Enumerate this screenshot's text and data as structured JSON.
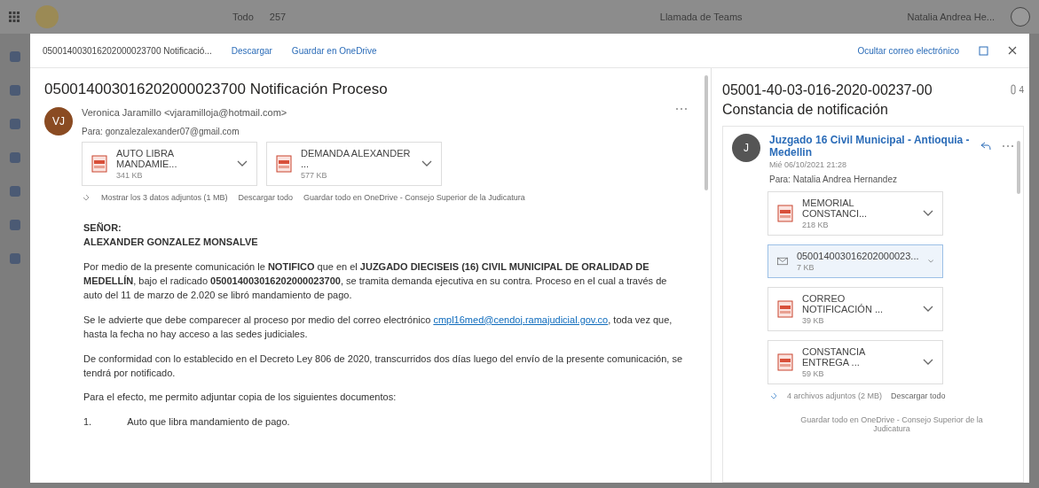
{
  "topbar": {
    "scope": "Todo",
    "count": "257",
    "teams_button": "Llamada de Teams",
    "user_name": "Natalia Andrea He..."
  },
  "header": {
    "title": "050014003016202000023700 Notificació...",
    "actions": [
      "Descargar",
      "Guardar en OneDrive"
    ],
    "hide_button": "Ocultar correo electrónico"
  },
  "message": {
    "subject": "050014003016202000023700 Notificación Proceso",
    "avatar": "VJ",
    "sender": "Veronica Jaramillo <vjaramilloja@hotmail.com>",
    "to_label": "Para:",
    "to": "gonzalezalexander07@gmail.com",
    "attachments": [
      {
        "name": "AUTO LIBRA MANDAMIE...",
        "size": "341 KB",
        "kind": "pdf"
      },
      {
        "name": "DEMANDA ALEXANDER ...",
        "size": "577 KB",
        "kind": "pdf"
      }
    ],
    "attachment_summary": "Mostrar los 3 datos adjuntos (1 MB)",
    "download_all": "Descargar todo",
    "save_all": "Guardar todo en OneDrive - Consejo Superior de la Judicatura",
    "greeting": [
      "SEÑOR:",
      "ALEXANDER GONZALEZ MONSALVE"
    ],
    "paragraphs": [
      {
        "text": "Por medio de la presente comunicación le **NOTIFICO** que en el **JUZGADO DIECISEIS (16) CIVIL MUNICIPAL DE ORALIDAD DE MEDELLÍN**, bajo el radicado **050014003016202000023700**, se tramita demanda ejecutiva en su contra. Proceso en el cual a través de auto del 11 de marzo de 2.020 se libró mandamiento de pago."
      },
      {
        "text": "Se le advierte que debe comparecer al proceso por medio del correo electrónico ",
        "link": "cmpl16med@cendoj.ramajudicial.gov.co",
        "after": ", toda vez que, hasta la fecha no hay acceso a las sedes judiciales."
      },
      {
        "text": "De conformidad con lo establecido en el Decreto Ley 806 de 2020, transcurridos dos días luego del envío de la presente comunicación, se tendrá por notificado."
      },
      {
        "text": "Para el efecto, me permito adjuntar copia de los siguientes documentos:"
      }
    ],
    "list": [
      {
        "number": "1.",
        "text": "Auto que libra mandamiento de pago."
      }
    ]
  },
  "thread": {
    "subject": "05001-40-03-016-2020-00237-00 Constancia de notificación",
    "count": "4",
    "avatar": "J",
    "sender": "Juzgado 16 Civil Municipal - Antioquia - Medellin",
    "date": "Mié 06/10/2021 21:28",
    "to": "Para: Natalia Andrea Hernandez",
    "attachments": [
      {
        "name": "MEMORIAL CONSTANCI...",
        "size": "218 KB",
        "kind": "pdf",
        "selected": false
      },
      {
        "name": "050014003016202000023...",
        "size": "7 KB",
        "kind": "email",
        "selected": true
      },
      {
        "name": "CORREO NOTIFICACIÓN ...",
        "size": "39 KB",
        "kind": "pdf",
        "selected": false
      },
      {
        "name": "CONSTANCIA ENTREGA ...",
        "size": "59 KB",
        "kind": "pdf",
        "selected": false
      }
    ],
    "attachment_summary": "4 archivos adjuntos (2 MB)",
    "download_all": "Descargar todo",
    "save_all": "Guardar todo en OneDrive - Consejo Superior de la Judicatura"
  }
}
